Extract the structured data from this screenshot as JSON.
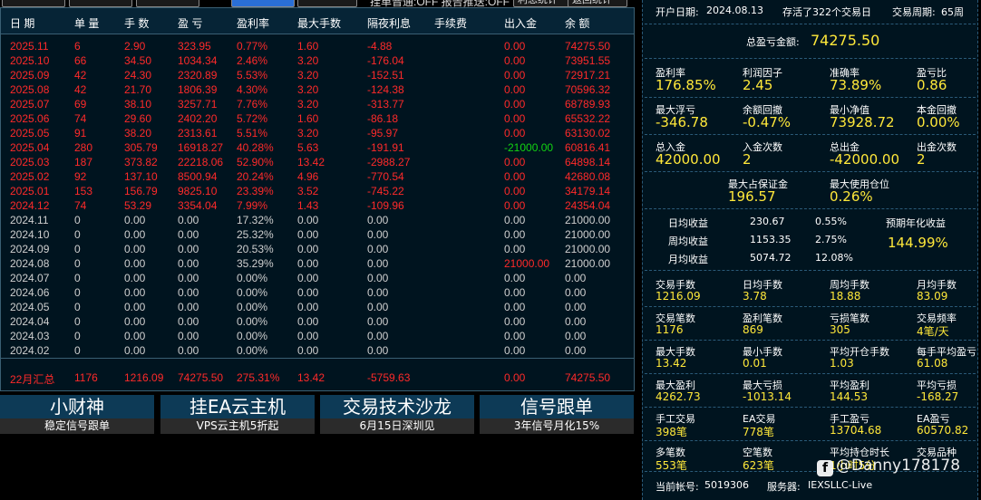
{
  "toolbar": {
    "info_text": "挂单普通:OFF   报告推送:OFF",
    "btn_right_1": "利息统计",
    "btn_right_2": "返回统计"
  },
  "table": {
    "headers": [
      "日 期",
      "单 量",
      "手 数",
      "盈 亏",
      "盈利率",
      "最大手数",
      "隔夜利息",
      "手续费",
      "出入金",
      "余 额"
    ],
    "rows": [
      {
        "date": "2025.11",
        "orders": "6",
        "lots": "2.90",
        "pnl": "323.95",
        "rate": "0.77%",
        "maxlots": "1.60",
        "swap": "-4.88",
        "fee": "",
        "cash": "0.00",
        "balance": "74275.50",
        "color": "red"
      },
      {
        "date": "2025.10",
        "orders": "66",
        "lots": "34.50",
        "pnl": "1034.34",
        "rate": "2.46%",
        "maxlots": "3.20",
        "swap": "-176.04",
        "fee": "",
        "cash": "0.00",
        "balance": "73951.55",
        "color": "red"
      },
      {
        "date": "2025.09",
        "orders": "42",
        "lots": "24.30",
        "pnl": "2320.89",
        "rate": "5.53%",
        "maxlots": "3.20",
        "swap": "-152.51",
        "fee": "",
        "cash": "0.00",
        "balance": "72917.21",
        "color": "red"
      },
      {
        "date": "2025.08",
        "orders": "42",
        "lots": "21.70",
        "pnl": "1806.39",
        "rate": "4.30%",
        "maxlots": "3.20",
        "swap": "-124.38",
        "fee": "",
        "cash": "0.00",
        "balance": "70596.32",
        "color": "red"
      },
      {
        "date": "2025.07",
        "orders": "69",
        "lots": "38.10",
        "pnl": "3257.71",
        "rate": "7.76%",
        "maxlots": "3.20",
        "swap": "-313.77",
        "fee": "",
        "cash": "0.00",
        "balance": "68789.93",
        "color": "red"
      },
      {
        "date": "2025.06",
        "orders": "74",
        "lots": "29.60",
        "pnl": "2402.20",
        "rate": "5.72%",
        "maxlots": "1.60",
        "swap": "-86.18",
        "fee": "",
        "cash": "0.00",
        "balance": "65532.22",
        "color": "red"
      },
      {
        "date": "2025.05",
        "orders": "91",
        "lots": "38.20",
        "pnl": "2313.61",
        "rate": "5.51%",
        "maxlots": "3.20",
        "swap": "-95.97",
        "fee": "",
        "cash": "0.00",
        "balance": "63130.02",
        "color": "red"
      },
      {
        "date": "2025.04",
        "orders": "280",
        "lots": "305.79",
        "pnl": "16918.27",
        "rate": "40.28%",
        "maxlots": "5.63",
        "swap": "-191.91",
        "fee": "",
        "cash": "-21000.00",
        "balance": "60816.41",
        "color": "red",
        "cash_color": "green"
      },
      {
        "date": "2025.03",
        "orders": "187",
        "lots": "373.82",
        "pnl": "22218.06",
        "rate": "52.90%",
        "maxlots": "13.42",
        "swap": "-2988.27",
        "fee": "",
        "cash": "0.00",
        "balance": "64898.14",
        "color": "red"
      },
      {
        "date": "2025.02",
        "orders": "92",
        "lots": "137.10",
        "pnl": "8500.94",
        "rate": "20.24%",
        "maxlots": "4.96",
        "swap": "-770.54",
        "fee": "",
        "cash": "0.00",
        "balance": "42680.08",
        "color": "red"
      },
      {
        "date": "2025.01",
        "orders": "153",
        "lots": "156.79",
        "pnl": "9825.10",
        "rate": "23.39%",
        "maxlots": "3.52",
        "swap": "-745.22",
        "fee": "",
        "cash": "0.00",
        "balance": "34179.14",
        "color": "red"
      },
      {
        "date": "2024.12",
        "orders": "74",
        "lots": "53.29",
        "pnl": "3354.04",
        "rate": "7.99%",
        "maxlots": "1.43",
        "swap": "-109.96",
        "fee": "",
        "cash": "0.00",
        "balance": "24354.04",
        "color": "red"
      },
      {
        "date": "2024.11",
        "orders": "0",
        "lots": "0.00",
        "pnl": "0.00",
        "rate": "17.32%",
        "maxlots": "0.00",
        "swap": "0.00",
        "fee": "",
        "cash": "0.00",
        "balance": "21000.00",
        "color": "gray"
      },
      {
        "date": "2024.10",
        "orders": "0",
        "lots": "0.00",
        "pnl": "0.00",
        "rate": "25.32%",
        "maxlots": "0.00",
        "swap": "0.00",
        "fee": "",
        "cash": "0.00",
        "balance": "21000.00",
        "color": "gray"
      },
      {
        "date": "2024.09",
        "orders": "0",
        "lots": "0.00",
        "pnl": "0.00",
        "rate": "20.53%",
        "maxlots": "0.00",
        "swap": "0.00",
        "fee": "",
        "cash": "0.00",
        "balance": "21000.00",
        "color": "gray"
      },
      {
        "date": "2024.08",
        "orders": "0",
        "lots": "0.00",
        "pnl": "0.00",
        "rate": "35.29%",
        "maxlots": "0.00",
        "swap": "0.00",
        "fee": "",
        "cash": "21000.00",
        "balance": "21000.00",
        "color": "gray",
        "cash_color": "red"
      },
      {
        "date": "2024.07",
        "orders": "0",
        "lots": "0.00",
        "pnl": "0.00",
        "rate": "0.00%",
        "maxlots": "0.00",
        "swap": "0.00",
        "fee": "",
        "cash": "0.00",
        "balance": "0.00",
        "color": "gray"
      },
      {
        "date": "2024.06",
        "orders": "0",
        "lots": "0.00",
        "pnl": "0.00",
        "rate": "0.00%",
        "maxlots": "0.00",
        "swap": "0.00",
        "fee": "",
        "cash": "0.00",
        "balance": "0.00",
        "color": "gray"
      },
      {
        "date": "2024.05",
        "orders": "0",
        "lots": "0.00",
        "pnl": "0.00",
        "rate": "0.00%",
        "maxlots": "0.00",
        "swap": "0.00",
        "fee": "",
        "cash": "0.00",
        "balance": "0.00",
        "color": "gray"
      },
      {
        "date": "2024.04",
        "orders": "0",
        "lots": "0.00",
        "pnl": "0.00",
        "rate": "0.00%",
        "maxlots": "0.00",
        "swap": "0.00",
        "fee": "",
        "cash": "0.00",
        "balance": "0.00",
        "color": "gray"
      },
      {
        "date": "2024.03",
        "orders": "0",
        "lots": "0.00",
        "pnl": "0.00",
        "rate": "0.00%",
        "maxlots": "0.00",
        "swap": "0.00",
        "fee": "",
        "cash": "0.00",
        "balance": "0.00",
        "color": "gray"
      },
      {
        "date": "2024.02",
        "orders": "0",
        "lots": "0.00",
        "pnl": "0.00",
        "rate": "0.00%",
        "maxlots": "0.00",
        "swap": "0.00",
        "fee": "",
        "cash": "0.00",
        "balance": "0.00",
        "color": "gray"
      }
    ],
    "summary": {
      "date": "22月汇总",
      "orders": "1176",
      "lots": "1216.09",
      "pnl": "74275.50",
      "rate": "275.31%",
      "maxlots": "13.42",
      "swap": "-5759.63",
      "fee": "",
      "cash": "0.00",
      "balance": "74275.50"
    }
  },
  "banners": [
    {
      "title": "小财神",
      "sub": "稳定信号跟单"
    },
    {
      "title": "挂EA云主机",
      "sub": "VPS云主机5折起"
    },
    {
      "title": "交易技术沙龙",
      "sub": "6月15日深圳见"
    },
    {
      "title": "信号跟单",
      "sub": "3年信号月化15%"
    }
  ],
  "stats": {
    "open_date_label": "开户日期:",
    "open_date": "2024.08.13",
    "survived": "存活了322个交易日",
    "cycle_label": "交易周期:",
    "cycle": "65周",
    "total_label": "总盈亏金额:",
    "total": "74275.50",
    "g1": [
      {
        "l": "盈利率",
        "v": "176.85%"
      },
      {
        "l": "利润因子",
        "v": "2.45"
      },
      {
        "l": "准确率",
        "v": "73.89%"
      },
      {
        "l": "盈亏比",
        "v": "0.86"
      }
    ],
    "g2": [
      {
        "l": "最大浮亏",
        "v": "-346.78"
      },
      {
        "l": "余额回撤",
        "v": "-0.47%"
      },
      {
        "l": "最小净值",
        "v": "73928.72"
      },
      {
        "l": "本金回撤",
        "v": "0.00%"
      }
    ],
    "g3": [
      {
        "l": "总入金",
        "v": "42000.00"
      },
      {
        "l": "入金次数",
        "v": "2"
      },
      {
        "l": "总出金",
        "v": "-42000.00"
      },
      {
        "l": "出金次数",
        "v": "2"
      }
    ],
    "g4": [
      {
        "l": "最大占保证金",
        "v": "196.57"
      },
      {
        "l": "最大使用仓位",
        "v": "0.26%"
      }
    ],
    "returns": [
      {
        "l": "日均收益",
        "a": "230.67",
        "p": "0.55%"
      },
      {
        "l": "周均收益",
        "a": "1153.35",
        "p": "2.75%"
      },
      {
        "l": "月均收益",
        "a": "5074.72",
        "p": "12.08%"
      }
    ],
    "annual_label": "预期年化收益",
    "annual": "144.99%",
    "g5": [
      {
        "l": "交易手数",
        "v": "1216.09"
      },
      {
        "l": "日均手数",
        "v": "3.78"
      },
      {
        "l": "周均手数",
        "v": "18.88"
      },
      {
        "l": "月均手数",
        "v": "83.09"
      }
    ],
    "g6": [
      {
        "l": "交易笔数",
        "v": "1176"
      },
      {
        "l": "盈利笔数",
        "v": "869"
      },
      {
        "l": "亏损笔数",
        "v": "305"
      },
      {
        "l": "交易频率",
        "v": "4笔/天"
      }
    ],
    "g7": [
      {
        "l": "最大手数",
        "v": "13.42"
      },
      {
        "l": "最小手数",
        "v": "0.01"
      },
      {
        "l": "平均开仓手数",
        "v": "1.03"
      },
      {
        "l": "每手平均盈亏",
        "v": "61.08"
      }
    ],
    "g8": [
      {
        "l": "最大盈利",
        "v": "4262.73"
      },
      {
        "l": "最大亏损",
        "v": "-1013.14"
      },
      {
        "l": "平均盈利",
        "v": "144.53"
      },
      {
        "l": "平均亏损",
        "v": "-168.27"
      }
    ],
    "g9": [
      {
        "l": "手工交易",
        "v": "398笔"
      },
      {
        "l": "EA交易",
        "v": "778笔"
      },
      {
        "l": "手工盈亏",
        "v": "13704.68"
      },
      {
        "l": "EA盈亏",
        "v": "60570.82"
      }
    ],
    "g10": [
      {
        "l": "多笔数",
        "v": "553笔"
      },
      {
        "l": "空笔数",
        "v": "623笔"
      },
      {
        "l": "平均持仓时长",
        "v": "1小时5分"
      },
      {
        "l": "交易品种",
        "v": ""
      }
    ],
    "account_label": "当前帐号:",
    "account": "5019306",
    "server_label": "服务器:",
    "server": "IEXSLLC-Live",
    "watermark": "@Danny178178"
  }
}
